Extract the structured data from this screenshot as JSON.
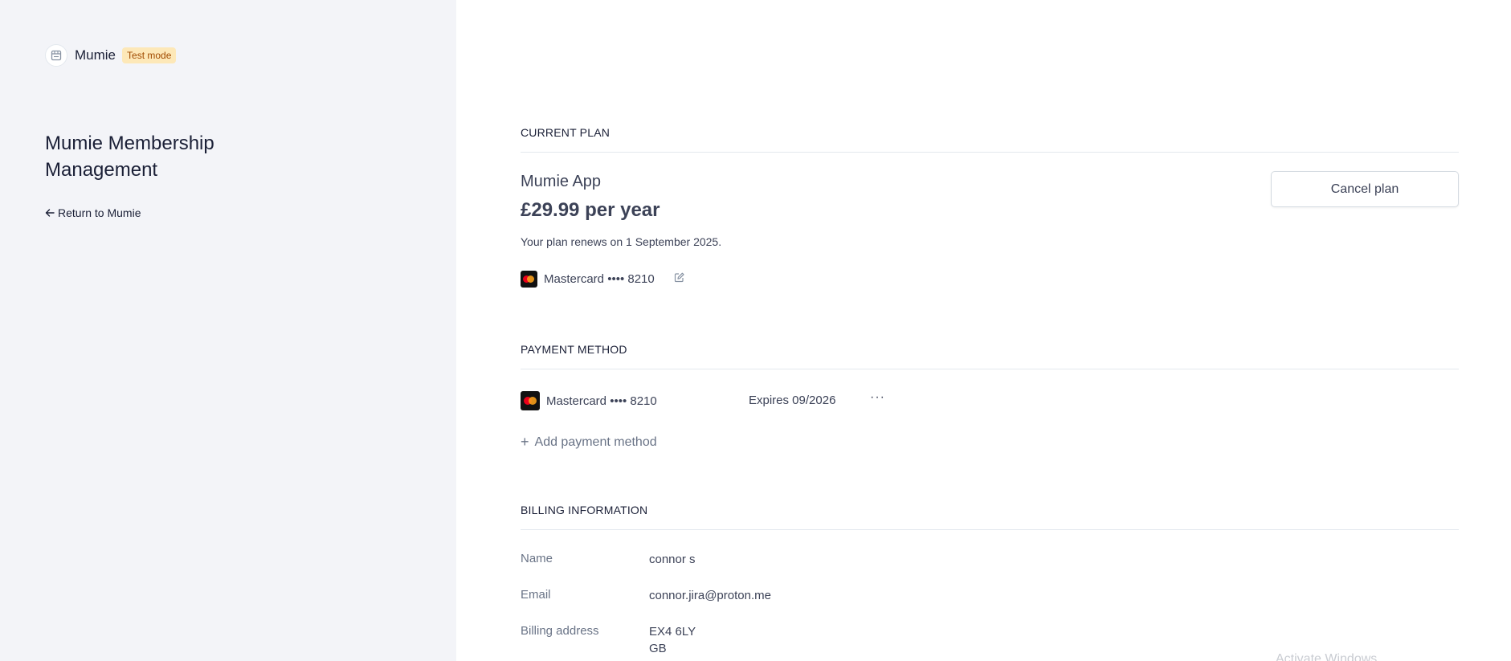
{
  "brand": {
    "name": "Mumie",
    "badge": "Test mode",
    "logo_icon": "store-icon"
  },
  "sidebar": {
    "title": "Mumie Membership Management",
    "return_link": "Return to Mumie"
  },
  "current_plan": {
    "section_title": "CURRENT PLAN",
    "plan_name": "Mumie App",
    "price": "£29.99 per year",
    "renewal_text": "Your plan renews on 1 September 2025.",
    "card_label": "Mastercard •••• 8210",
    "cancel_button": "Cancel plan"
  },
  "payment_method": {
    "section_title": "PAYMENT METHOD",
    "card_label": "Mastercard •••• 8210",
    "expires": "Expires 09/2026",
    "more": "···",
    "add_label": "Add payment method"
  },
  "billing": {
    "section_title": "BILLING INFORMATION",
    "rows": [
      {
        "label": "Name",
        "value": "connor s"
      },
      {
        "label": "Email",
        "value": "connor.jira@proton.me"
      },
      {
        "label": "Billing address",
        "value_line1": "EX4 6LY",
        "value_line2": "GB"
      }
    ]
  },
  "watermark": "Activate Windows",
  "colors": {
    "sidebar_bg": "#f3f4f8",
    "badge_bg": "#fde8b8",
    "badge_text": "#a04a00",
    "mastercard_red": "#eb001b",
    "mastercard_orange": "#f79e1b"
  }
}
